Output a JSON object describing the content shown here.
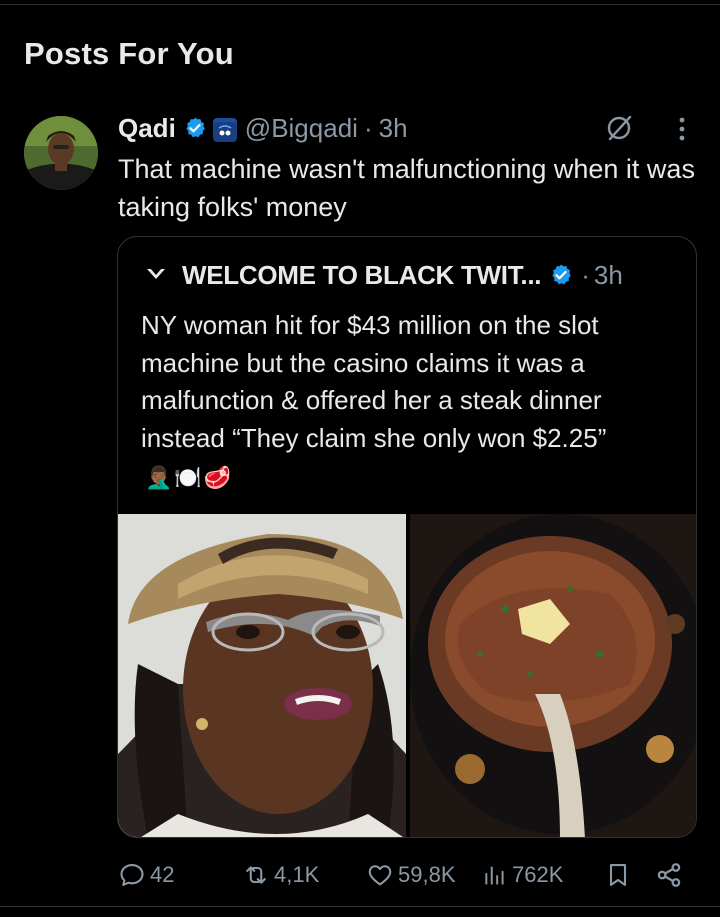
{
  "section": {
    "title": "Posts For You"
  },
  "post": {
    "author_name": "Qadi",
    "handle": "@Bigqadi",
    "separator": "·",
    "time": "3h",
    "text": "That machine wasn't malfunctioning when it was taking folks' money"
  },
  "quote": {
    "author_name": "WELCOME TO BLACK TWIT...",
    "separator": "·",
    "time": "3h",
    "text": "NY woman hit for $43 million on the slot machine but the casino claims it was a malfunction & offered her a steak dinner instead “They claim she only won $2.25”",
    "emojis": [
      "🤦🏾‍♂️",
      "🍽️",
      "🥩"
    ]
  },
  "actions": {
    "replies": "42",
    "reposts": "4,1K",
    "likes": "59,8K",
    "views": "762K"
  },
  "colors": {
    "background": "#000000",
    "text": "#e7e9ea",
    "muted": "#8b98a5",
    "verified": "#1d9bf0",
    "border": "#2f3336"
  },
  "icons": [
    "verified-badge-icon",
    "affiliate-badge-icon",
    "grok-icon",
    "more-icon",
    "reply-icon",
    "repost-icon",
    "like-icon",
    "views-icon",
    "bookmark-icon",
    "share-icon"
  ]
}
